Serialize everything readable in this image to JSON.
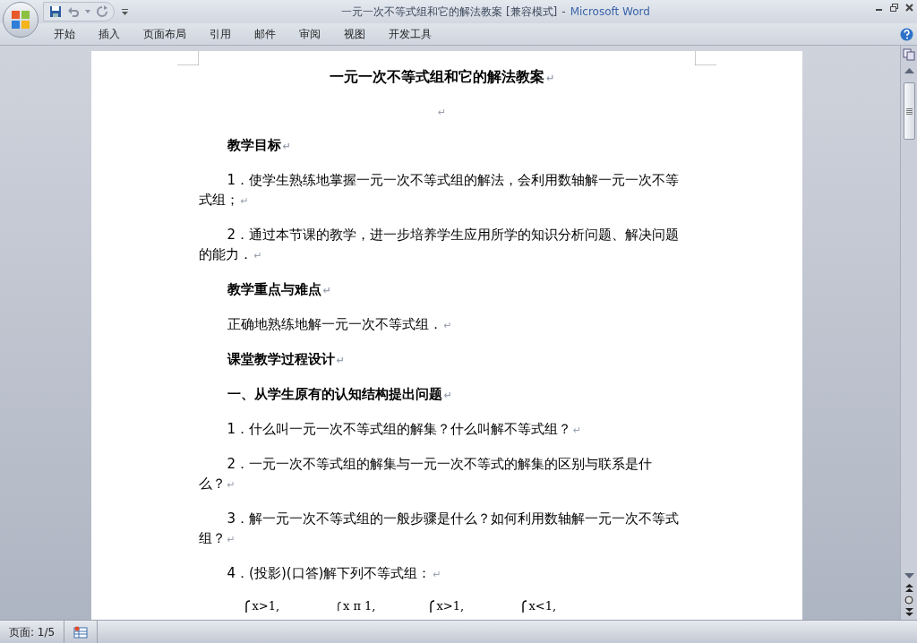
{
  "window": {
    "document_title": "一元一次不等式组和它的解法教案 [兼容模式]",
    "separator": "-",
    "app_name": "Microsoft Word"
  },
  "tabs": [
    {
      "label": "开始"
    },
    {
      "label": "插入"
    },
    {
      "label": "页面布局"
    },
    {
      "label": "引用"
    },
    {
      "label": "邮件"
    },
    {
      "label": "审阅"
    },
    {
      "label": "视图"
    },
    {
      "label": "开发工具"
    }
  ],
  "document": {
    "paragraphs": [
      {
        "kind": "title",
        "text": "一元一次不等式组和它的解法教案",
        "mark": "↵"
      },
      {
        "kind": "blank",
        "mark": "↵"
      },
      {
        "kind": "heading",
        "text": "教学目标",
        "mark": "↵"
      },
      {
        "kind": "body",
        "text": "1．使学生熟练地掌握一元一次不等式组的解法，会利用数轴解一元一次不等式组；",
        "mark": "↵"
      },
      {
        "kind": "body",
        "text": "2．通过本节课的教学，进一步培养学生应用所学的知识分析问题、解决问题的能力．",
        "mark": "↵"
      },
      {
        "kind": "heading",
        "text": "教学重点与难点",
        "mark": "↵"
      },
      {
        "kind": "body",
        "text": "正确地熟练地解一元一次不等式组．",
        "mark": "↵"
      },
      {
        "kind": "heading",
        "text": "课堂教学过程设计",
        "mark": "↵"
      },
      {
        "kind": "heading",
        "text": "一、从学生原有的认知结构提出问题",
        "mark": "↵"
      },
      {
        "kind": "body",
        "text": "1．什么叫一元一次不等式组的解集？什么叫解不等式组？",
        "mark": "↵"
      },
      {
        "kind": "body",
        "text": "2．一元一次不等式组的解集与一元一次不等式的解集的区别与联系是什么？",
        "mark": "↵"
      },
      {
        "kind": "body",
        "text": "3．解一元一次不等式组的一般步骤是什么？如何利用数轴解一元一次不等式组？",
        "mark": "↵"
      },
      {
        "kind": "body",
        "text": "4．(投影)(口答)解下列不等式组：",
        "mark": "↵"
      }
    ],
    "systems": [
      {
        "first_line": "x>1,"
      },
      {
        "first_line": "x π 1,"
      },
      {
        "first_line": "x>1,"
      },
      {
        "first_line": "x<1,"
      }
    ]
  },
  "status_bar": {
    "page": "页面: 1/5"
  }
}
